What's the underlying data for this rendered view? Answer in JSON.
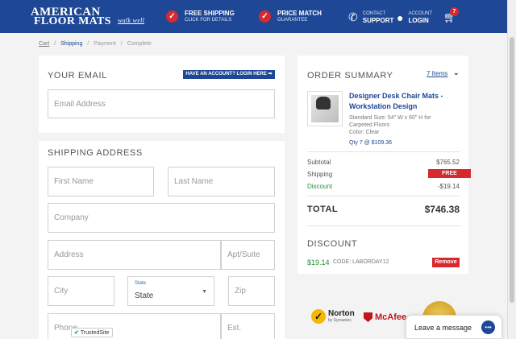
{
  "header": {
    "logo_line1": "AMERICAN",
    "logo_line2": "FLOOR MATS",
    "logo_tagline": "walk well",
    "promo1_title": "FREE SHIPPING",
    "promo1_sub": "CLICK FOR DETAILS",
    "promo2_title": "PRICE MATCH",
    "promo2_sub": "GUARANTEE",
    "contact_small": "CONTACT",
    "contact_big": "SUPPORT",
    "account_small": "ACCOUNT",
    "account_big": "LOGIN",
    "cart_count": "7",
    "colors": {
      "bar": "#1e4796",
      "badge": "#d72a2f"
    }
  },
  "breadcrumb": {
    "items": [
      "Cart",
      "Shipping",
      "Payment",
      "Complete"
    ],
    "separator": "/",
    "active": "Shipping"
  },
  "email_section": {
    "title": "YOUR EMAIL",
    "login_button": "HAVE AN ACCOUNT? LOGIN HERE ➡",
    "email_placeholder": "Email Address"
  },
  "shipping_section": {
    "title": "SHIPPING ADDRESS",
    "first_name": "First Name",
    "last_name": "Last Name",
    "company": "Company",
    "address": "Address",
    "apt": "Apt/Suite",
    "city": "City",
    "state_label": "State",
    "state_value": "State",
    "zip": "Zip",
    "phone": "Phone",
    "ext": "Ext."
  },
  "order_summary": {
    "title": "ORDER SUMMARY",
    "items_link": "7 Items",
    "product": {
      "name": "Designer Desk Chair Mats - Workstation Design",
      "size": "Standard Size: 54\" W x 60\" H for Carpeted Floors",
      "color": "Color: Clear",
      "qty": "Qty 7 @ $109.36"
    },
    "subtotal_label": "Subtotal",
    "subtotal_value": "$765.52",
    "shipping_label": "Shipping",
    "shipping_value": "FREE",
    "discount_label": "Discount",
    "discount_value": "-$19.14",
    "total_label": "TOTAL",
    "total_value": "$746.38"
  },
  "discount_section": {
    "title": "DISCOUNT",
    "amount": "$19.14",
    "code": "CODE: LABORDAY12",
    "remove_button": "Remove"
  },
  "badges": {
    "trusted_site": "TrustedSite",
    "norton": "Norton",
    "norton_by": "by Symantec",
    "mcafee": "McAfee"
  },
  "chat": {
    "label": "Leave a message"
  }
}
